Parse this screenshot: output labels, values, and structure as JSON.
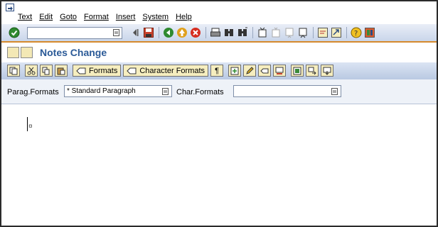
{
  "menu": {
    "items": [
      "Text",
      "Edit",
      "Goto",
      "Format",
      "Insert",
      "System",
      "Help"
    ]
  },
  "command_field": {
    "value": ""
  },
  "page": {
    "title": "Notes Change"
  },
  "app_toolbar": {
    "formats_label": "Formats",
    "character_formats_label": "Character Formats",
    "pilcrow": "¶"
  },
  "form": {
    "parag_label": "Parag.Formats",
    "parag_value": "* Standard Paragraph",
    "char_label": "Char.Formats",
    "char_value": ""
  },
  "editor": {
    "paragraph_mark": "¤"
  },
  "colors": {
    "title": "#2b5a97",
    "toolbar_separator": "#d68a2c",
    "button_fill": "#f6eebf"
  }
}
